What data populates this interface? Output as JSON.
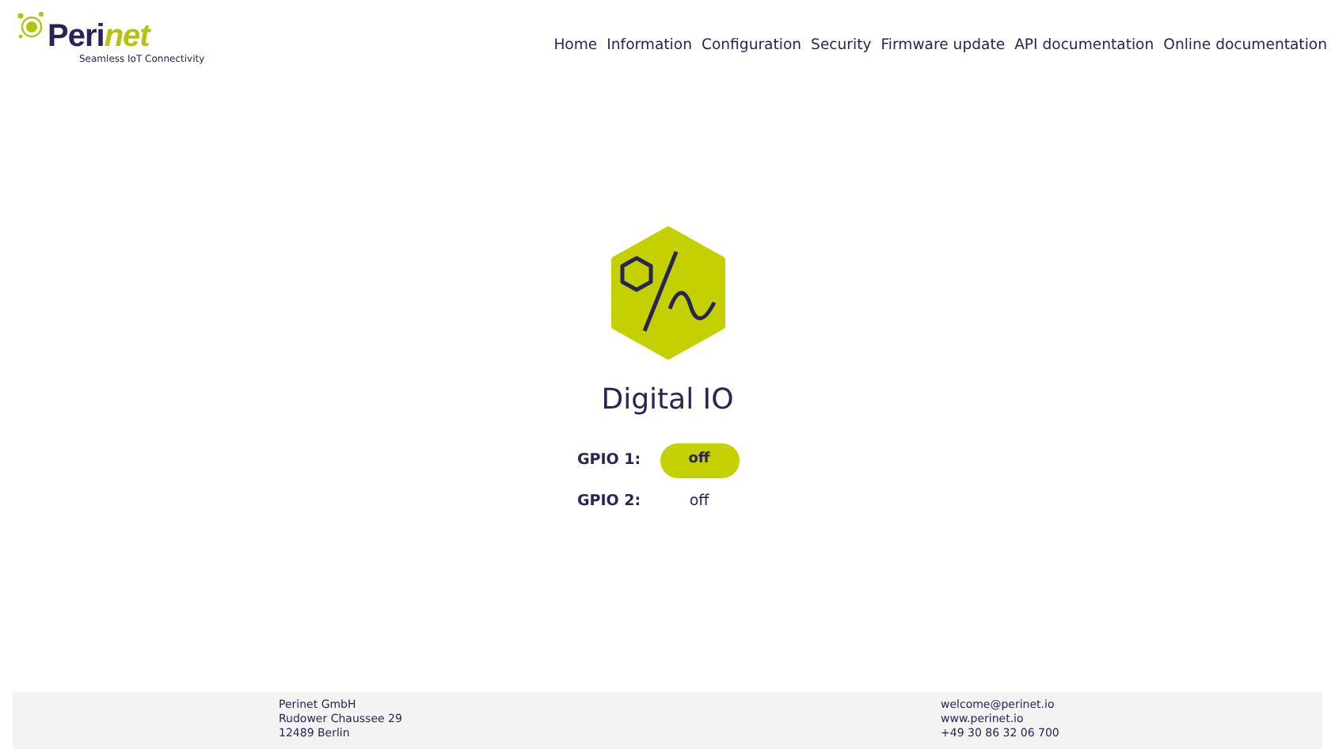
{
  "logo": {
    "name_start": "Peri",
    "name_end": "net",
    "tagline": "Seamless IoT Connectivity"
  },
  "nav": [
    {
      "label": "Home"
    },
    {
      "label": "Information"
    },
    {
      "label": "Configuration"
    },
    {
      "label": "Security"
    },
    {
      "label": "Firmware update"
    },
    {
      "label": "API documentation"
    },
    {
      "label": "Online documentation"
    }
  ],
  "title": "Digital IO",
  "gpios": [
    {
      "label": "GPIO 1:",
      "kind": "button",
      "value": "off"
    },
    {
      "label": "GPIO 2:",
      "kind": "text",
      "value": "off"
    }
  ],
  "footer": {
    "left": [
      "Perinet GmbH",
      "Rudower Chaussee 29",
      "12489 Berlin"
    ],
    "right": [
      "welcome@perinet.io",
      "www.perinet.io",
      "+49 30 86 32 06 700"
    ]
  }
}
